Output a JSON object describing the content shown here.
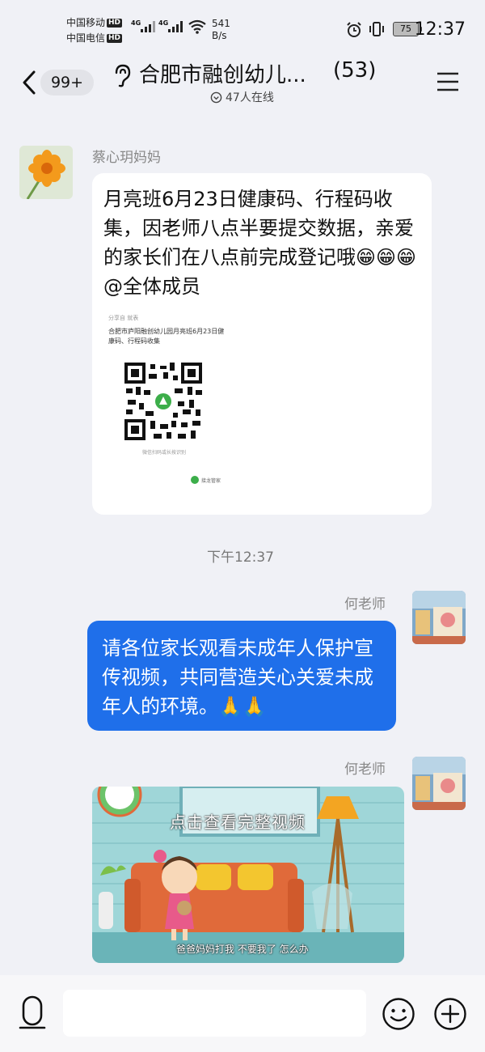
{
  "status_bar": {
    "carrier1": "中国移动",
    "carrier2": "中国电信",
    "hd": "HD",
    "net1": "4G",
    "net2": "4G",
    "speed_value": "541",
    "speed_unit": "B/s",
    "battery": "75",
    "time": "12:37"
  },
  "header": {
    "unread_badge": "99+",
    "title": "合肥市融创幼儿...",
    "member_count": "(53)",
    "online": "47人在线"
  },
  "messages": [
    {
      "sender": "蔡心玥妈妈",
      "text": "月亮班6月23日健康码、行程码收集，因老师八点半要提交数据，亲爱的家长们在八点前完成登记哦😁😁😁@全体成员",
      "card": {
        "tag": "分享自  就表",
        "title": "合肥市庐阳融创幼儿园月亮班6月23日健康码、行程码收集",
        "caption": "微信扫码或长按识别",
        "brand": "接龙管家"
      }
    },
    {
      "timestamp": "下午12:37"
    },
    {
      "sender": "何老师",
      "text": "请各位家长观看未成年人保护宣传视频，共同营造关心关爱未成年人的环境。🙏🙏"
    },
    {
      "sender": "何老师",
      "video": {
        "overlay": "点击查看完整视频",
        "subtitle": "爸爸妈妈打我  不要我了 怎么办"
      }
    }
  ],
  "colors": {
    "background": "#f0f1f6",
    "bubble_blue": "#1f6fea",
    "bubble_white": "#ffffff"
  }
}
